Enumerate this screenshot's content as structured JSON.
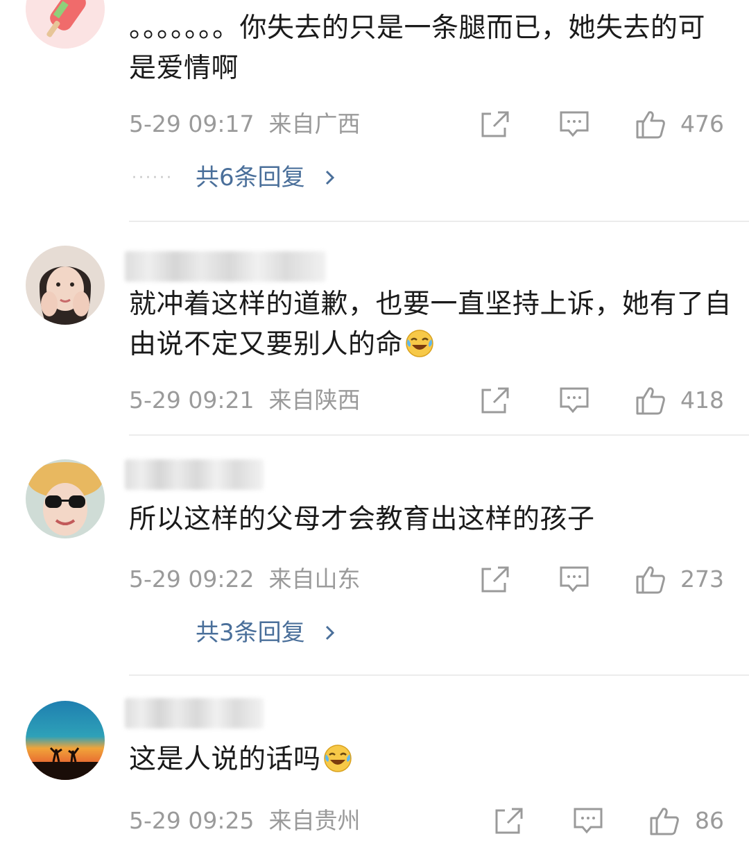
{
  "comments": [
    {
      "text": "。。。。。。。你失去的只是一条腿而已，她失去的可是爱情啊",
      "time": "5-29 09:17",
      "location": "来自广西",
      "likes": "476",
      "replies": "共6条回复"
    },
    {
      "text": "就冲着这样的道歉，也要一直坚持上诉，她有了自由说不定又要别人的命",
      "time": "5-29 09:21",
      "location": "来自陕西",
      "likes": "418",
      "emoji": "laughing-tears"
    },
    {
      "text": "所以这样的父母才会教育出这样的孩子",
      "time": "5-29 09:22",
      "location": "来自山东",
      "likes": "273",
      "replies": "共3条回复"
    },
    {
      "text": "这是人说的话吗",
      "time": "5-29 09:25",
      "location": "来自贵州",
      "likes": "86",
      "emoji": "laughing-tears"
    }
  ],
  "icons": {
    "share": "share-icon",
    "comment": "comment-icon",
    "like": "thumbs-up-icon",
    "more_replies": "chevron-right-icon"
  },
  "colors": {
    "text": "#1a1a1a",
    "meta": "#9a9a9a",
    "link": "#4a6f9a",
    "divider": "#ececec"
  }
}
